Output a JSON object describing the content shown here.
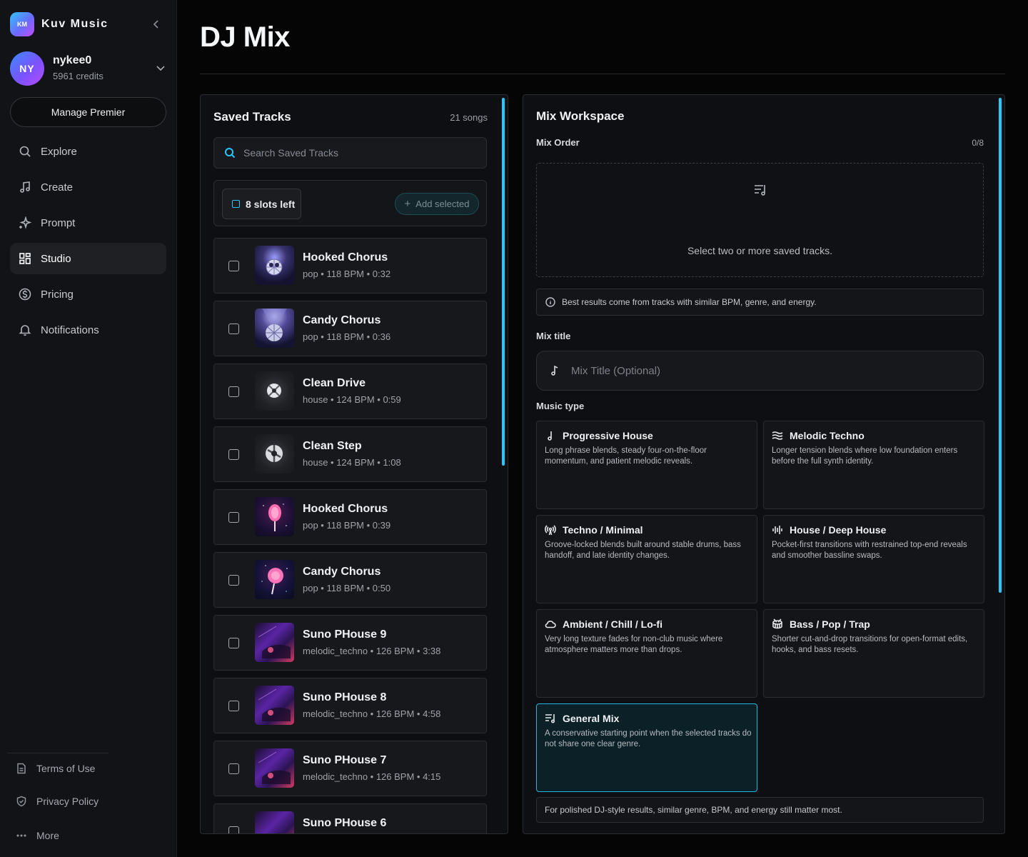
{
  "app": {
    "logo_text": "KM",
    "name": "Kuv Music"
  },
  "user": {
    "initials": "NY",
    "name": "nykee0",
    "credits": "5961 credits"
  },
  "sidebar": {
    "premier_label": "Manage Premier",
    "items": [
      {
        "label": "Explore",
        "icon": "search-icon"
      },
      {
        "label": "Create",
        "icon": "music-note-icon"
      },
      {
        "label": "Prompt",
        "icon": "sparkle-icon"
      },
      {
        "label": "Studio",
        "icon": "grid-icon",
        "active": true
      },
      {
        "label": "Pricing",
        "icon": "dollar-icon"
      },
      {
        "label": "Notifications",
        "icon": "bell-icon"
      }
    ],
    "footer": [
      {
        "label": "Terms of Use",
        "icon": "document-icon"
      },
      {
        "label": "Privacy Policy",
        "icon": "shield-icon"
      },
      {
        "label": "More",
        "icon": "more-icon"
      }
    ]
  },
  "page": {
    "title": "DJ Mix"
  },
  "saved": {
    "title": "Saved Tracks",
    "count": "21 songs",
    "search_placeholder": "Search Saved Tracks",
    "slots_left": "8 slots left",
    "add_selected": "Add selected",
    "tracks": [
      {
        "name": "Hooked Chorus",
        "meta": "pop • 118 BPM • 0:32",
        "art": "disco"
      },
      {
        "name": "Candy Chorus",
        "meta": "pop • 118 BPM • 0:36",
        "art": "disco2"
      },
      {
        "name": "Clean Drive",
        "meta": "house • 124 BPM • 0:59",
        "art": "dark"
      },
      {
        "name": "Clean Step",
        "meta": "house • 124 BPM • 1:08",
        "art": "dark"
      },
      {
        "name": "Hooked Chorus",
        "meta": "pop • 118 BPM • 0:39",
        "art": "lolly"
      },
      {
        "name": "Candy Chorus",
        "meta": "pop • 118 BPM • 0:50",
        "art": "lolly2"
      },
      {
        "name": "Suno PHouse 9",
        "meta": "melodic_techno • 126 BPM • 3:38",
        "art": "techno"
      },
      {
        "name": "Suno PHouse 8",
        "meta": "melodic_techno • 126 BPM • 4:58",
        "art": "techno"
      },
      {
        "name": "Suno PHouse 7",
        "meta": "melodic_techno • 126 BPM • 4:15",
        "art": "techno"
      },
      {
        "name": "Suno PHouse 6",
        "meta": "",
        "art": "techno"
      }
    ]
  },
  "workspace": {
    "title": "Mix Workspace",
    "mix_order_label": "Mix Order",
    "mix_order_count": "0/8",
    "empty_text": "Select two or more saved tracks.",
    "tip": "Best results come from tracks with similar BPM, genre, and energy.",
    "mix_title_label": "Mix title",
    "mix_title_placeholder": "Mix Title (Optional)",
    "music_type_label": "Music type",
    "types": [
      {
        "name": "Progressive House",
        "icon": "note-icon",
        "desc": "Long phrase blends, steady four-on-the-floor momentum, and patient melodic reveals."
      },
      {
        "name": "Melodic Techno",
        "icon": "waves-icon",
        "desc": "Longer tension blends where low foundation enters before the full synth identity."
      },
      {
        "name": "Techno / Minimal",
        "icon": "radio-icon",
        "desc": "Groove-locked blends built around stable drums, bass handoff, and late identity changes."
      },
      {
        "name": "House / Deep House",
        "icon": "audio-lines-icon",
        "desc": "Pocket-first transitions with restrained top-end reveals and smoother bassline swaps."
      },
      {
        "name": "Ambient / Chill / Lo-fi",
        "icon": "cloud-icon",
        "desc": "Very long texture fades for non-club music where atmosphere matters more than drops."
      },
      {
        "name": "Bass / Pop / Trap",
        "icon": "drum-icon",
        "desc": "Shorter cut-and-drop transitions for open-format edits, hooks, and bass resets."
      },
      {
        "name": "General Mix",
        "icon": "list-music-icon",
        "desc": "A conservative starting point when the selected tracks do not share one clear genre.",
        "selected": true
      }
    ],
    "bottom_note": "For polished DJ-style results, similar genre, BPM, and energy still matter most."
  },
  "colors": {
    "accent": "#26c6ff",
    "selected_card_bg": "#0c2027"
  }
}
